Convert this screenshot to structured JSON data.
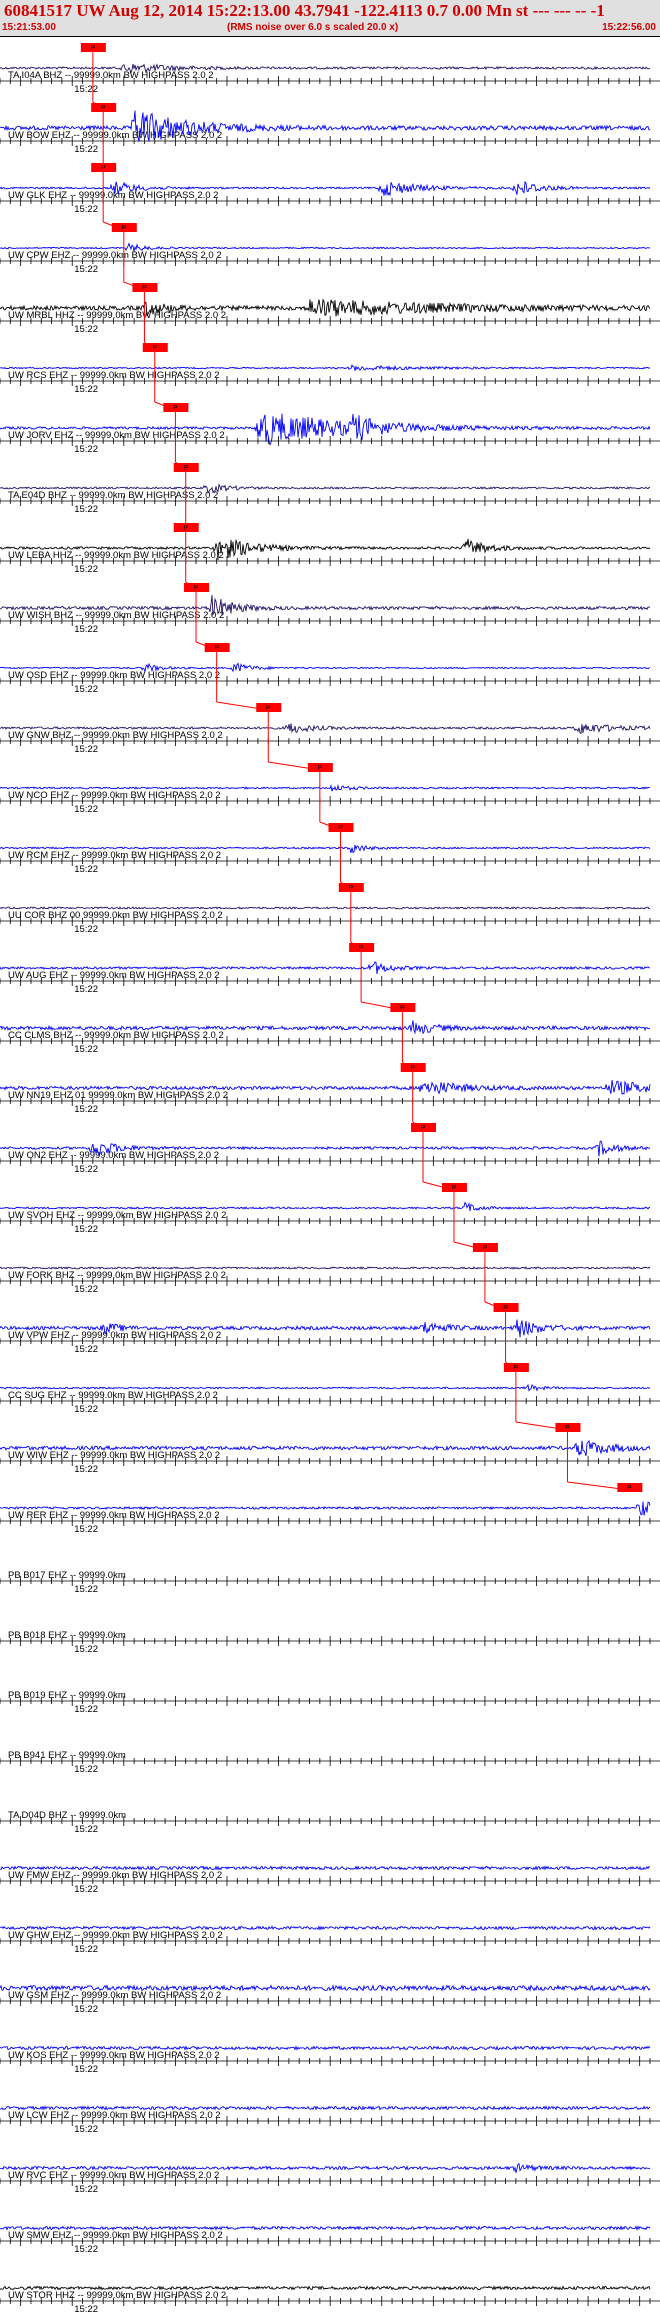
{
  "header": {
    "title": "60841517 UW Aug 12, 2014 15:22:13.00   43.7941 -122.4113  0.7 0.00 Mn st --- --- --  -1",
    "start_time": "15:21:53.00",
    "rms_note": "(RMS noise over 6.0 s scaled 20.0 x)",
    "end_time": "15:22:56.00"
  },
  "colors": {
    "trace_blue": "#0000ff",
    "trace_black": "#000000",
    "trace_purple": "#221166",
    "pick_red": "#ff0000",
    "header_red": "#d00000",
    "header_bg": "#e0e0e0"
  },
  "chart_data": {
    "type": "seismogram",
    "time_range": [
      "15:21:53.00",
      "15:22:56.00"
    ],
    "minute_label": "15:22",
    "pick_label": "P",
    "channels": [
      {
        "label": "TA I04A BHZ -- 99999.0km BW  HIGHPASS  2.0  2",
        "color": "#221166",
        "pick_s": 9.0,
        "noise": 0.18,
        "bursts": [
          [
            12,
            4,
            0.9
          ]
        ]
      },
      {
        "label": "UW BOW EHZ -- 99999.0km BW  HIGHPASS  2.0  2",
        "color": "#0000ff",
        "pick_s": 10.0,
        "noise": 0.35,
        "bursts": [
          [
            13,
            4.5,
            3.2
          ]
        ]
      },
      {
        "label": "UW GLK EHZ -- 99999.0km BW  HIGHPASS  2.0  2",
        "color": "#0000ff",
        "pick_s": 10.0,
        "noise": 0.15,
        "bursts": [
          [
            11,
            2,
            1.2
          ],
          [
            37,
            3,
            1.4
          ],
          [
            50,
            2,
            1.5
          ]
        ]
      },
      {
        "label": "UW CPW EHZ -- 99999.0km BW  HIGHPASS  2.0  2",
        "color": "#0000ff",
        "pick_s": 12.0,
        "noise": 0.12,
        "bursts": [
          [
            12.5,
            1.5,
            0.7
          ]
        ]
      },
      {
        "label": "UW MRBL HHZ -- 99999.0km BW  HIGHPASS  2.0  2",
        "color": "#000000",
        "pick_s": 14.0,
        "noise": 0.35,
        "bursts": [
          [
            14,
            2,
            1.2
          ],
          [
            30,
            12,
            1.4
          ]
        ]
      },
      {
        "label": "UW RCS EHZ -- 99999.0km BW  HIGHPASS  2.0  2",
        "color": "#0000ff",
        "pick_s": 15.0,
        "noise": 0.12,
        "bursts": [
          [
            34,
            6,
            0.4
          ]
        ]
      },
      {
        "label": "UW JORV EHZ -- 99999.0km BW  HIGHPASS  2.0  2",
        "color": "#0000ff",
        "pick_s": 17.0,
        "noise": 0.2,
        "bursts": [
          [
            25,
            8,
            3.0
          ],
          [
            34,
            2,
            1.6
          ]
        ]
      },
      {
        "label": "TA E04D BHZ -- 99999.0km BW  HIGHPASS  2.0  2",
        "color": "#221166",
        "pick_s": 18.0,
        "noise": 0.15,
        "bursts": [
          [
            20,
            2,
            0.8
          ]
        ]
      },
      {
        "label": "UW LEBA HHZ -- 99999.0km BW  HIGHPASS  2.0  2",
        "color": "#000000",
        "pick_s": 18.0,
        "noise": 0.2,
        "bursts": [
          [
            21,
            3,
            2.2
          ],
          [
            45,
            2,
            1.6
          ]
        ]
      },
      {
        "label": "UW WISH BHZ -- 99999.0km BW  HIGHPASS  2.0  2",
        "color": "#221166",
        "pick_s": 19.0,
        "noise": 0.25,
        "bursts": [
          [
            20.5,
            2,
            2.0
          ]
        ]
      },
      {
        "label": "UW OSD EHZ -- 99999.0km BW  HIGHPASS  2.0  2",
        "color": "#0000ff",
        "pick_s": 21.0,
        "noise": 0.12,
        "bursts": [
          [
            14,
            1.2,
            0.8
          ],
          [
            22.5,
            1.5,
            1.0
          ]
        ]
      },
      {
        "label": "UW GNW BHZ -- 99999.0km BW  HIGHPASS  2.0  2",
        "color": "#221166",
        "pick_s": 26.0,
        "noise": 0.18,
        "bursts": [
          [
            28,
            2,
            0.9
          ],
          [
            56,
            3,
            1.0
          ]
        ]
      },
      {
        "label": "UW NCO EHZ -- 99999.0km BW  HIGHPASS  2.0  2",
        "color": "#0000ff",
        "pick_s": 31.0,
        "noise": 0.14,
        "bursts": [
          [
            32,
            1.5,
            0.6
          ]
        ]
      },
      {
        "label": "UW RCM EHZ -- 99999.0km BW  HIGHPASS  2.0  2",
        "color": "#0000ff",
        "pick_s": 33.0,
        "noise": 0.14,
        "bursts": [
          [
            34,
            1.2,
            0.9
          ]
        ]
      },
      {
        "label": "UU COR BHZ 00 99999.0km BW  HIGHPASS  2.0  2",
        "color": "#221166",
        "pick_s": 34.0,
        "noise": 0.15,
        "bursts": []
      },
      {
        "label": "UW AUG EHZ -- 99999.0km BW  HIGHPASS  2.0  2",
        "color": "#0000ff",
        "pick_s": 35.0,
        "noise": 0.2,
        "bursts": [
          [
            36,
            1.5,
            1.2
          ]
        ]
      },
      {
        "label": "CC CLMS BHZ -- 99999.0km BW  HIGHPASS  2.0  2",
        "color": "#0000ff",
        "pick_s": 39.0,
        "noise": 0.3,
        "bursts": [
          [
            40,
            2,
            1.0
          ]
        ]
      },
      {
        "label": "UW NN19 EHZ 01 99999.0km BW  HIGHPASS  2.0  2",
        "color": "#0000ff",
        "pick_s": 40.0,
        "noise": 0.28,
        "bursts": [
          [
            41,
            3,
            1.4
          ],
          [
            59,
            4,
            1.2
          ]
        ]
      },
      {
        "label": "UW ON2 EHZ -- 99999.0km BW  HIGHPASS  2.0  2",
        "color": "#0000ff",
        "pick_s": 41.0,
        "noise": 0.2,
        "bursts": [
          [
            9,
            2,
            1.6
          ],
          [
            58,
            1.5,
            1.3
          ]
        ]
      },
      {
        "label": "UW SVOH EHZ -- 99999.0km BW  HIGHPASS  2.0  2",
        "color": "#0000ff",
        "pick_s": 44.0,
        "noise": 0.15,
        "bursts": [
          [
            45,
            1.2,
            0.9
          ]
        ]
      },
      {
        "label": "UW FORK BHZ -- 99999.0km BW  HIGHPASS  2.0  2",
        "color": "#221166",
        "pick_s": 47.0,
        "noise": 0.15,
        "bursts": []
      },
      {
        "label": "UW VPW EHZ -- 99999.0km BW  HIGHPASS  2.0  2",
        "color": "#0000ff",
        "pick_s": 49.0,
        "noise": 0.28,
        "bursts": [
          [
            10,
            1.5,
            0.9
          ],
          [
            41,
            2,
            1.0
          ],
          [
            50,
            2,
            1.6
          ]
        ]
      },
      {
        "label": "CC SUG EHZ -- 99999.0km BW  HIGHPASS  2.0  2",
        "color": "#0000ff",
        "pick_s": 50.0,
        "noise": 0.14,
        "bursts": [
          [
            51,
            1.2,
            0.6
          ]
        ]
      },
      {
        "label": "UW WIW EHZ -- 99999.0km BW  HIGHPASS  2.0  2",
        "color": "#0000ff",
        "pick_s": 55.0,
        "noise": 0.3,
        "bursts": [
          [
            56,
            2.5,
            1.6
          ]
        ]
      },
      {
        "label": "UW RER EHZ -- 99999.0km BW  HIGHPASS  2.0  2",
        "color": "#0000ff",
        "pick_s": 61.0,
        "noise": 0.18,
        "bursts": [
          [
            62,
            1.5,
            1.5
          ]
        ]
      },
      {
        "label": "PB B017 EHZ -- 99999.0km",
        "color": "#0000ff",
        "pick_s": null,
        "noise": 0,
        "bursts": []
      },
      {
        "label": "PB B018 EHZ -- 99999.0km",
        "color": "#0000ff",
        "pick_s": null,
        "noise": 0,
        "bursts": []
      },
      {
        "label": "PB B019 EHZ -- 99999.0km",
        "color": "#0000ff",
        "pick_s": null,
        "noise": 0,
        "bursts": []
      },
      {
        "label": "PB B941 EHZ -- 99999.0km",
        "color": "#0000ff",
        "pick_s": null,
        "noise": 0,
        "bursts": []
      },
      {
        "label": "TA D04D BHZ -- 99999.0km",
        "color": "#0000ff",
        "pick_s": null,
        "noise": 0,
        "bursts": []
      },
      {
        "label": "UW FMW EHZ -- 99999.0km BW  HIGHPASS  2.0  2",
        "color": "#0000ff",
        "pick_s": null,
        "noise": 0.25,
        "bursts": []
      },
      {
        "label": "UW GHW EHZ -- 99999.0km BW  HIGHPASS  2.0  2",
        "color": "#0000ff",
        "pick_s": null,
        "noise": 0.25,
        "bursts": []
      },
      {
        "label": "UW GSM EHZ -- 99999.0km BW  HIGHPASS  2.0  2",
        "color": "#0000ff",
        "pick_s": null,
        "noise": 0.4,
        "bursts": []
      },
      {
        "label": "UW KOS EHZ -- 99999.0km BW  HIGHPASS  2.0  2",
        "color": "#0000ff",
        "pick_s": null,
        "noise": 0.25,
        "bursts": []
      },
      {
        "label": "UW LCW EHZ -- 99999.0km BW  HIGHPASS  2.0  2",
        "color": "#0000ff",
        "pick_s": null,
        "noise": 0.25,
        "bursts": []
      },
      {
        "label": "UW RVC EHZ -- 99999.0km BW  HIGHPASS  2.0  2",
        "color": "#0000ff",
        "pick_s": null,
        "noise": 0.25,
        "bursts": [
          [
            50,
            1.5,
            0.6
          ]
        ]
      },
      {
        "label": "UW SMW EHZ -- 99999.0km BW  HIGHPASS  2.0  2",
        "color": "#0000ff",
        "pick_s": null,
        "noise": 0.25,
        "bursts": []
      },
      {
        "label": "UW STOR HHZ -- 99999.0km BW  HIGHPASS  2.0  2",
        "color": "#000000",
        "pick_s": null,
        "noise": 0.25,
        "bursts": []
      }
    ]
  }
}
